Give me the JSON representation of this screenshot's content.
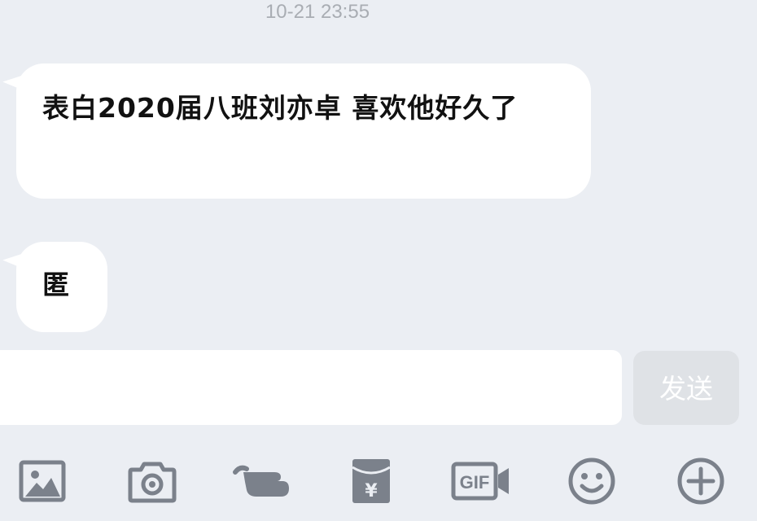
{
  "header": {
    "timestamp": "10-21 23:55"
  },
  "messages": [
    {
      "text": "表白2020届八班刘亦卓 喜欢他好久了"
    },
    {
      "text": "匿"
    }
  ],
  "composer": {
    "input_value": "",
    "send_label": "发送"
  },
  "toolbar": {
    "icons": [
      "image-icon",
      "camera-icon",
      "poke-icon",
      "red-packet-icon",
      "gif-icon",
      "emoji-icon",
      "plus-icon"
    ],
    "red_packet_symbol": "¥",
    "gif_label": "GIF"
  },
  "colors": {
    "background": "#ebeef3",
    "bubble": "#ffffff",
    "icon": "#7b818b",
    "send_disabled": "#dfe2e6",
    "timestamp": "#a9adb3"
  }
}
